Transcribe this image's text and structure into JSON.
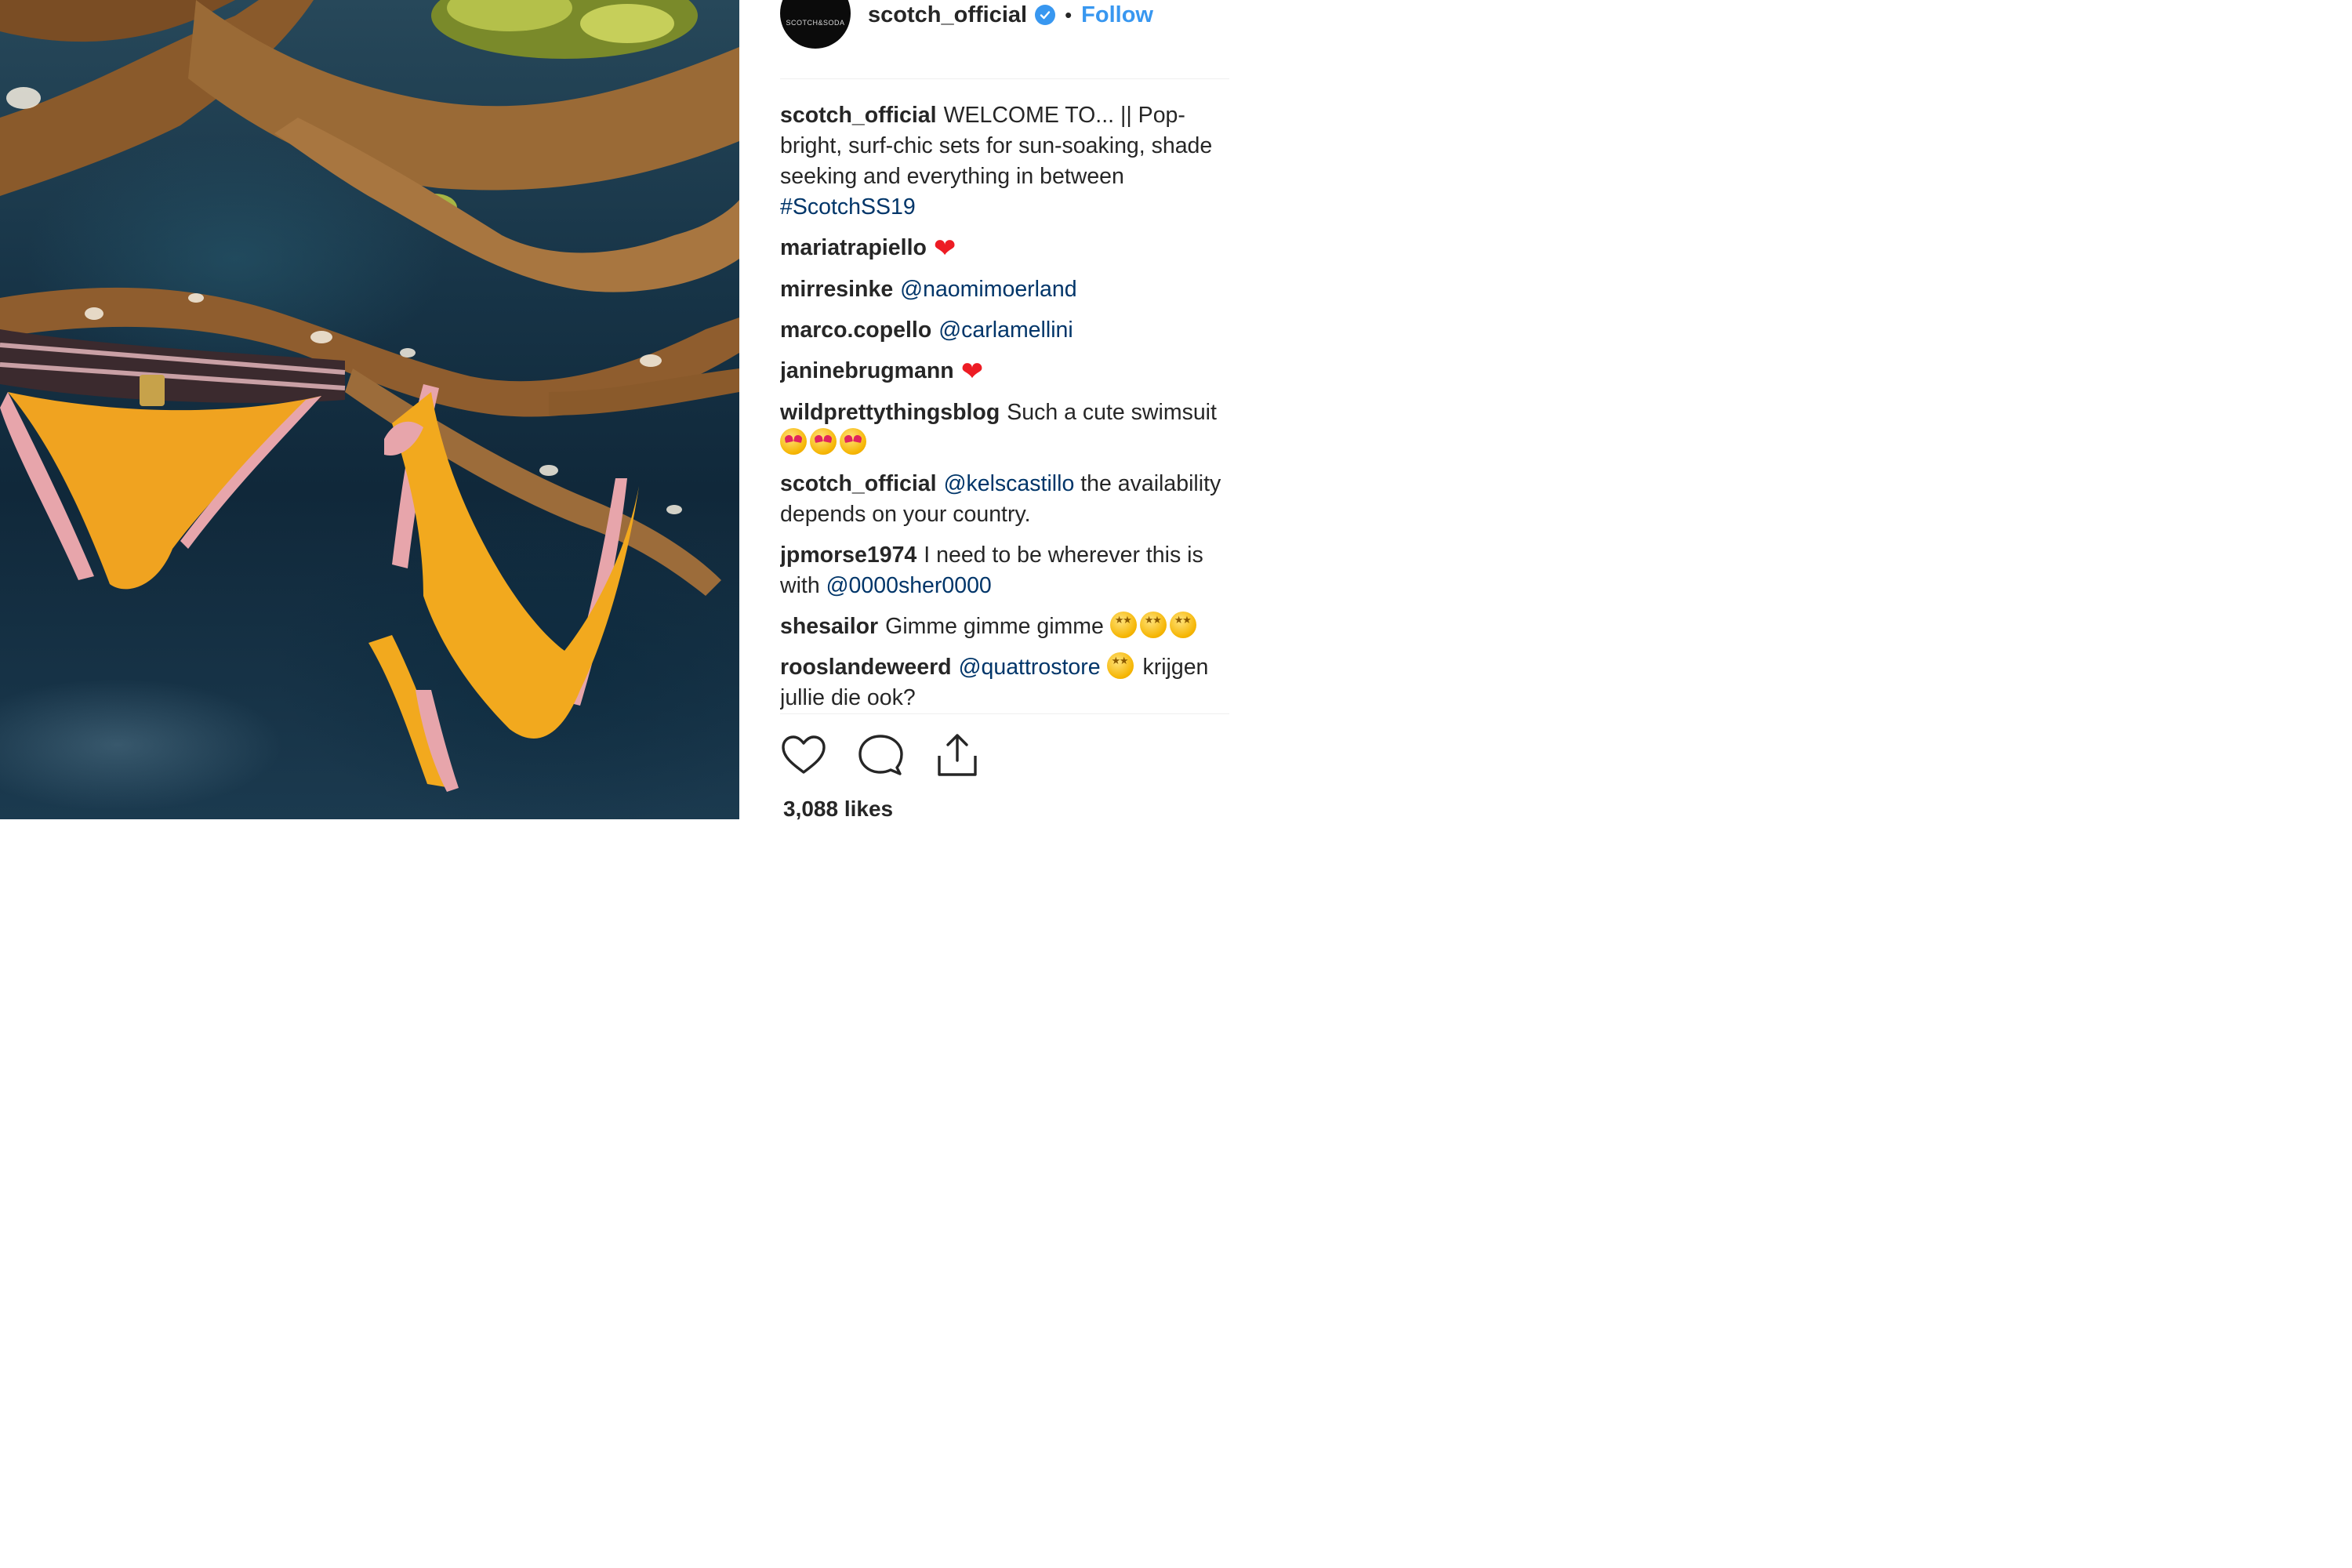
{
  "post": {
    "username": "scotch_official",
    "separator": "•",
    "follow_label": "Follow",
    "avatar_text": "SCOTCH&SODA"
  },
  "comments": [
    {
      "user": "scotch_official",
      "parts": [
        {
          "type": "text",
          "text": "WELCOME TO... || Pop-bright, surf-chic sets for sun-soaking, shade seeking and everything in between "
        },
        {
          "type": "hashtag",
          "text": "#ScotchSS19"
        }
      ]
    },
    {
      "user": "mariatrapiello",
      "parts": [
        {
          "type": "emoji",
          "icon": "red-heart",
          "text": "❤"
        }
      ]
    },
    {
      "user": "mirresinke",
      "parts": [
        {
          "type": "mention",
          "text": "@naomimoerland"
        }
      ]
    },
    {
      "user": "marco.copello",
      "parts": [
        {
          "type": "mention",
          "text": "@carlamellini"
        }
      ]
    },
    {
      "user": "janinebrugmann",
      "parts": [
        {
          "type": "emoji",
          "icon": "red-heart",
          "text": "❤"
        }
      ]
    },
    {
      "user": "wildprettythingsblog",
      "parts": [
        {
          "type": "text",
          "text": "Such a cute swimsuit "
        },
        {
          "type": "emoji",
          "icon": "heart-eyes"
        },
        {
          "type": "emoji",
          "icon": "heart-eyes"
        },
        {
          "type": "emoji",
          "icon": "heart-eyes"
        }
      ]
    },
    {
      "user": "scotch_official",
      "parts": [
        {
          "type": "mention",
          "text": "@kelscastillo"
        },
        {
          "type": "text",
          "text": " the availability depends on your country."
        }
      ]
    },
    {
      "user": "jpmorse1974",
      "parts": [
        {
          "type": "text",
          "text": "I need to be wherever this is with "
        },
        {
          "type": "mention",
          "text": "@0000sher0000"
        }
      ]
    },
    {
      "user": "shesailor",
      "parts": [
        {
          "type": "text",
          "text": "Gimme gimme gimme "
        },
        {
          "type": "emoji",
          "icon": "star-struck"
        },
        {
          "type": "emoji",
          "icon": "star-struck"
        },
        {
          "type": "emoji",
          "icon": "star-struck"
        }
      ]
    },
    {
      "user": "rooslandeweerd",
      "parts": [
        {
          "type": "mention",
          "text": "@quattrostore"
        },
        {
          "type": "text",
          "text": " "
        },
        {
          "type": "emoji",
          "icon": "star-struck"
        },
        {
          "type": "text",
          "text": " krijgen jullie die ook?"
        }
      ]
    }
  ],
  "actions": [
    {
      "name": "like-button",
      "icon": "heart-outline-icon"
    },
    {
      "name": "comment-button",
      "icon": "comment-bubble-icon"
    },
    {
      "name": "share-button",
      "icon": "share-upload-icon"
    }
  ],
  "likes_text": "3,088 likes",
  "colors": {
    "link": "#003569",
    "follow": "#3897f0",
    "verified": "#3897f0",
    "heart": "#ed1c24",
    "text": "#262626"
  }
}
